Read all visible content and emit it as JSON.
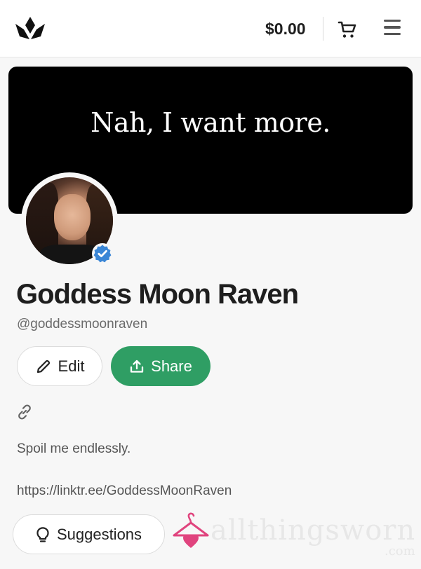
{
  "header": {
    "balance": "$0.00",
    "logo_icon": "crown-leaf-logo-icon",
    "cart_icon": "cart-icon",
    "menu_icon": "hamburger-menu-icon"
  },
  "banner": {
    "text": "Nah, I want more."
  },
  "profile": {
    "name": "Goddess Moon Raven",
    "handle": "@goddessmoonraven",
    "verified_icon": "verified-badge-icon",
    "verified_color": "#3a86d6",
    "edit_label": "Edit",
    "share_label": "Share",
    "share_color": "#2f9e64",
    "bio": "Spoil me endlessly.",
    "link": "https://linktr.ee/GoddessMoonRaven",
    "suggestions_label": "Suggestions"
  },
  "watermark": {
    "text": "allthingsworn",
    "suffix": ".com",
    "icon": "hanger-heart-icon",
    "color": "#e0447e"
  }
}
